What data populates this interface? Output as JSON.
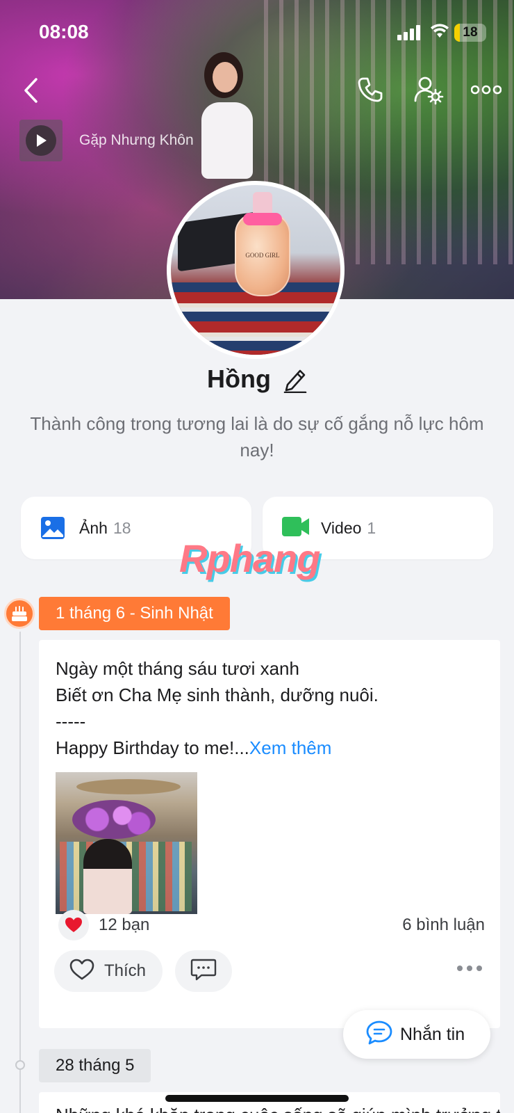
{
  "status_bar": {
    "time": "08:08",
    "battery": "18",
    "battery_level": 0.18
  },
  "header": {
    "music_title": "Gặp Nhưng Khôn",
    "icons": [
      "back-arrow-icon",
      "phone-icon",
      "user-settings-icon",
      "more-icon"
    ]
  },
  "profile": {
    "name": "Hồng",
    "bio": "Thành công trong tương lai là do sự cố gắng nỗ lực hôm nay!",
    "avatar_label": "GOOD GIRL"
  },
  "media": {
    "photos": {
      "label": "Ảnh",
      "count": "18"
    },
    "videos": {
      "label": "Video",
      "count": "1"
    }
  },
  "watermark": "Rphang",
  "timeline": {
    "birthday_tag": "1 tháng 6 - Sinh Nhật",
    "post": {
      "lines": [
        "Ngày một tháng sáu tươi xanh",
        "Biết ơn Cha Mẹ sinh thành, dưỡng nuôi.",
        "-----",
        "Happy Birthday to me!..."
      ],
      "see_more": "Xem thêm",
      "reactions": "12 bạn",
      "comments": "6 bình luận",
      "like_label": "Thích"
    },
    "next_date": "28 tháng 5",
    "next_post_text": "Những khó khăn trong cuộc sống sẽ giúp mình trưởng thành hơn"
  },
  "chat_button": "Nhắn tin",
  "colors": {
    "accent": "#1a8cff",
    "birthday": "#ff7a36",
    "photo_icon": "#1a6fe6",
    "video_icon": "#2fbf5a"
  }
}
